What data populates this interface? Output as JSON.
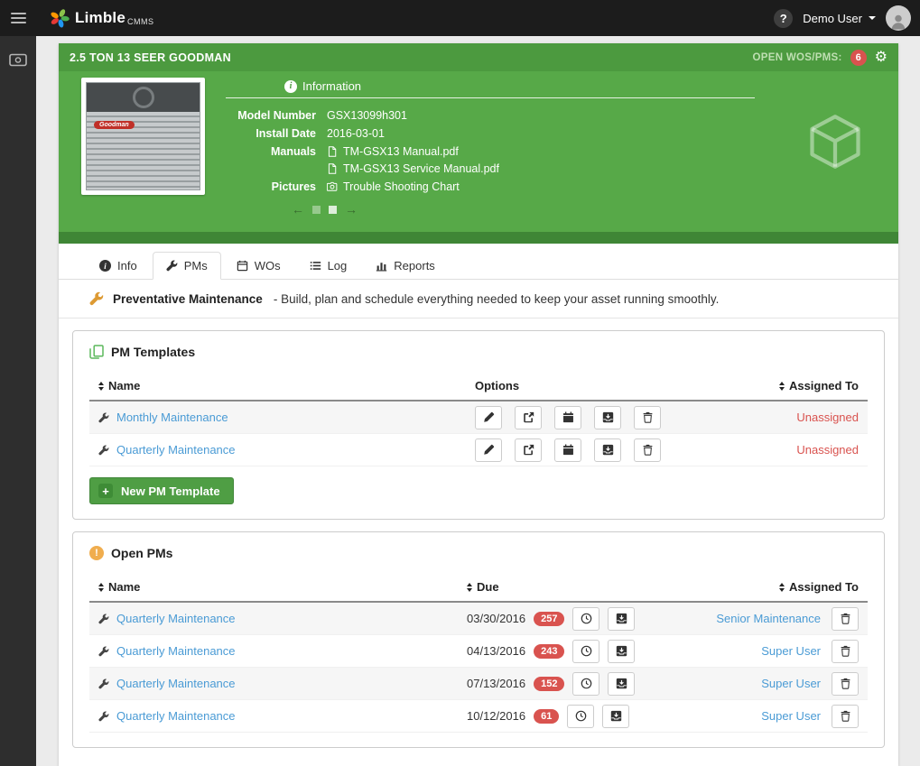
{
  "topbar": {
    "brand": "Limble",
    "brand_suffix": "CMMS",
    "user_name": "Demo User",
    "help_label": "?"
  },
  "asset_card": {
    "title": "2.5 TON 13 SEER GOODMAN",
    "open_label": "OPEN WOS/PMS:",
    "open_count": "6",
    "info_title": "Information",
    "model_label": "Model Number",
    "model_value": "GSX13099h301",
    "install_label": "Install Date",
    "install_value": "2016-03-01",
    "manuals_label": "Manuals",
    "manuals": [
      "TM-GSX13 Manual.pdf",
      "TM-GSX13 Service Manual.pdf"
    ],
    "pictures_label": "Pictures",
    "pictures": [
      "Trouble Shooting Chart"
    ],
    "photo_brand": "Goodman"
  },
  "tabs": {
    "info": "Info",
    "pms": "PMs",
    "wos": "WOs",
    "log": "Log",
    "reports": "Reports"
  },
  "banner": {
    "title": "Preventative Maintenance",
    "text": "- Build, plan and schedule everything needed to keep your asset running smoothly."
  },
  "pm_templates": {
    "title": "PM Templates",
    "col_name": "Name",
    "col_options": "Options",
    "col_assigned": "Assigned To",
    "rows": [
      {
        "name": "Monthly Maintenance",
        "assigned": "Unassigned"
      },
      {
        "name": "Quarterly Maintenance",
        "assigned": "Unassigned"
      }
    ],
    "new_button": "New PM Template"
  },
  "open_pms": {
    "title": "Open PMs",
    "col_name": "Name",
    "col_due": "Due",
    "col_assigned": "Assigned To",
    "rows": [
      {
        "name": "Quarterly Maintenance",
        "due": "03/30/2016",
        "overdue_days": "257",
        "assigned": "Senior Maintenance"
      },
      {
        "name": "Quarterly Maintenance",
        "due": "04/13/2016",
        "overdue_days": "243",
        "assigned": "Super User"
      },
      {
        "name": "Quarterly Maintenance",
        "due": "07/13/2016",
        "overdue_days": "152",
        "assigned": "Super User"
      },
      {
        "name": "Quarterly Maintenance",
        "due": "10/12/2016",
        "overdue_days": "61",
        "assigned": "Super User"
      }
    ]
  },
  "colors": {
    "green_header": "#4c9a3f",
    "green_body": "#57a948",
    "green_footer": "#3f8636",
    "danger_red": "#d9534f",
    "warning_orange": "#f0ad4e",
    "link_blue": "#4a9bd5"
  }
}
